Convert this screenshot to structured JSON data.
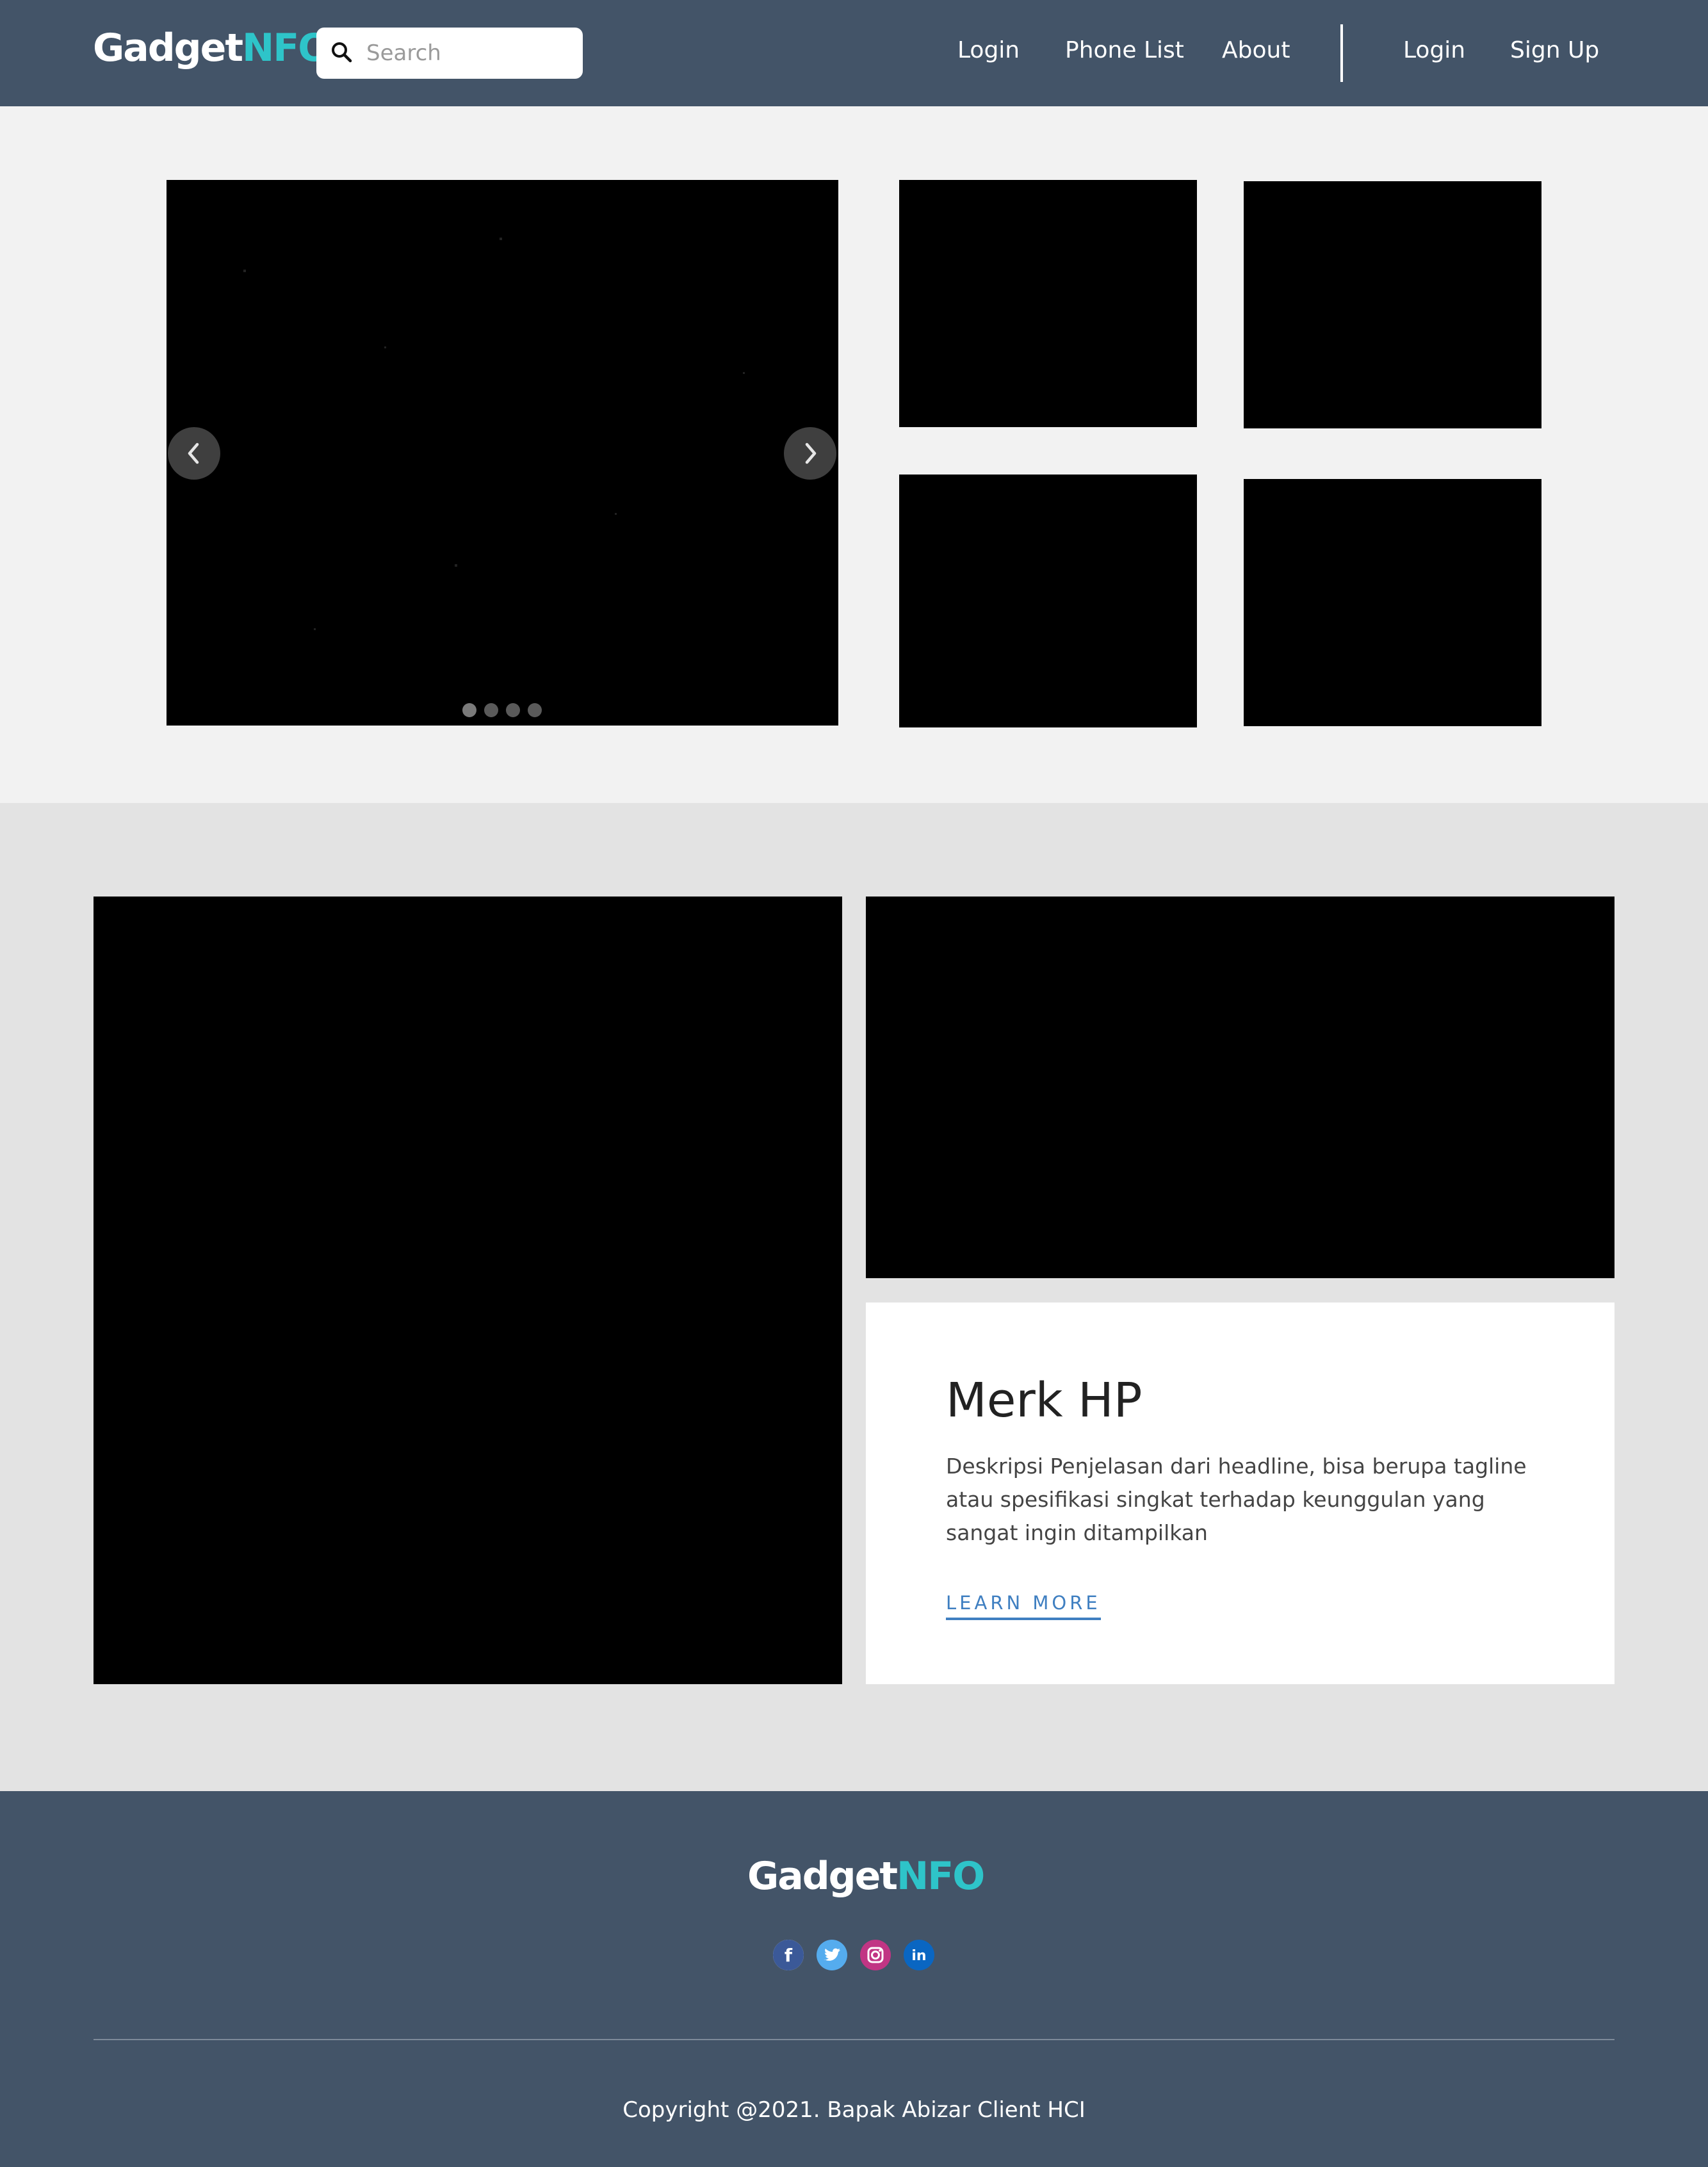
{
  "brand": {
    "part1": "Gadget",
    "part2": "NFO",
    "part2_color": "#2ec4c9"
  },
  "search": {
    "placeholder": "Search",
    "value": ""
  },
  "nav": {
    "links": [
      "Login",
      "Phone List",
      "About"
    ],
    "auth": {
      "login": "Login",
      "signup": "Sign Up"
    }
  },
  "carousel": {
    "slide_count": 4,
    "active_index": 0
  },
  "feature": {
    "title": "Merk HP",
    "description": "Deskripsi Penjelasan dari headline, bisa berupa tagline atau spesifikasi singkat terhadap keunggulan yang sangat ingin ditampilkan",
    "cta": "LEARN MORE"
  },
  "footer": {
    "socials": [
      "facebook-icon",
      "twitter-icon",
      "instagram-icon",
      "linkedin-icon"
    ],
    "copyright": "Copyright @2021. Bapak Abizar Client HCI"
  },
  "colors": {
    "navbar": "#435468",
    "accent": "#2ec4c9",
    "link": "#3f7fc1"
  }
}
